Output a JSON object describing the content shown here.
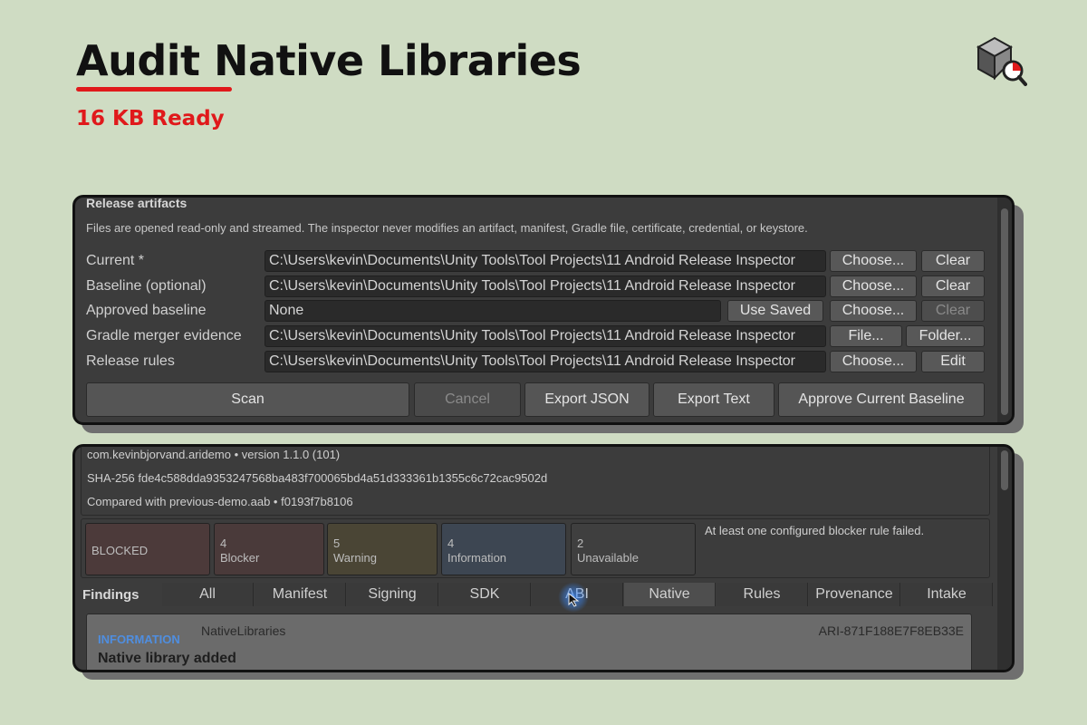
{
  "header": {
    "title": "Audit Native Libraries",
    "subtitle": "16 KB Ready",
    "logo_icon": "package-search-icon",
    "accent_color": "#e0191b"
  },
  "artifacts": {
    "section_title": "Release artifacts",
    "description": "Files are opened read-only and streamed. The inspector never modifies an artifact, manifest, Gradle file, certificate, credential, or keystore.",
    "rows": [
      {
        "label": "Current *",
        "value": "C:\\Users\\kevin\\Documents\\Unity Tools\\Tool Projects\\11 Android Release Inspector",
        "buttons": [
          "Choose...",
          "Clear"
        ]
      },
      {
        "label": "Baseline (optional)",
        "value": "C:\\Users\\kevin\\Documents\\Unity Tools\\Tool Projects\\11 Android Release Inspector",
        "buttons": [
          "Choose...",
          "Clear"
        ]
      },
      {
        "label": "Approved baseline",
        "value": "None",
        "buttons": [
          "Use Saved",
          "Choose...",
          "Clear"
        ]
      },
      {
        "label": "Gradle merger evidence",
        "value": "C:\\Users\\kevin\\Documents\\Unity Tools\\Tool Projects\\11 Android Release Inspector",
        "buttons": [
          "File...",
          "Folder..."
        ]
      },
      {
        "label": "Release rules",
        "value": "C:\\Users\\kevin\\Documents\\Unity Tools\\Tool Projects\\11 Android Release Inspector",
        "buttons": [
          "Choose...",
          "Edit"
        ]
      }
    ],
    "actions": {
      "scan": "Scan",
      "cancel": "Cancel",
      "export_json": "Export JSON",
      "export_text": "Export Text",
      "approve": "Approve Current Baseline"
    }
  },
  "report": {
    "package_line": "com.kevinbjorvand.aridemo  •  version 1.1.0 (101)",
    "sha_line": "SHA-256  fde4c588dda9353247568ba483f700065bd4a51d333361b1355c6c72cac9502d",
    "compared_line": "Compared with previous-demo.aab  •  f0193f7b8106",
    "status": {
      "verdict": "BLOCKED",
      "blocker": {
        "count": "4",
        "label": "Blocker"
      },
      "warning": {
        "count": "5",
        "label": "Warning"
      },
      "information": {
        "count": "4",
        "label": "Information"
      },
      "unavailable": {
        "count": "2",
        "label": "Unavailable"
      },
      "message": "At least one configured blocker rule failed.",
      "colors": {
        "blocked": "#4c3a3a",
        "blocker": "#4a3a3a",
        "warning": "#4a4535",
        "information": "#3d4652",
        "unavailable": "#3f3f3f"
      }
    },
    "findings_label": "Findings",
    "tabs": [
      "All",
      "Manifest",
      "Signing",
      "SDK",
      "ABI",
      "Native",
      "Rules",
      "Provenance",
      "Intake"
    ],
    "active_tab": "Native",
    "finding": {
      "severity": "INFORMATION",
      "category": "NativeLibraries",
      "id": "ARI-871F188E7F8EB33E",
      "title": "Native library added",
      "severity_color": "#4f8ee0"
    }
  }
}
